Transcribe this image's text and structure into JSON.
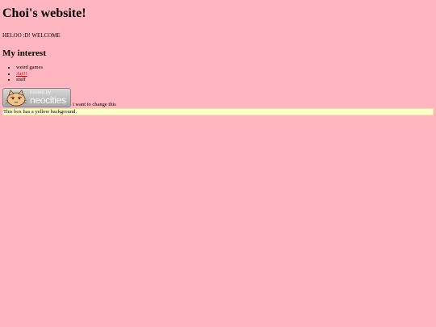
{
  "header": {
    "title": "Choi's website!"
  },
  "intro": {
    "text": "HELOO :D! WELCOME"
  },
  "interests": {
    "heading": "My interest",
    "items": [
      {
        "label": "weird games"
      },
      {
        "label": "Art?!"
      },
      {
        "label": "stuff"
      }
    ]
  },
  "badge": {
    "hosted_by": "hosted by",
    "brand": "neocities",
    "caption": "i want to change this"
  },
  "yellow_box": {
    "text": "This box has a yellow background."
  },
  "colors": {
    "background": "#ffb6c1",
    "box_background": "#ffffcc",
    "link": "#cc0000"
  }
}
